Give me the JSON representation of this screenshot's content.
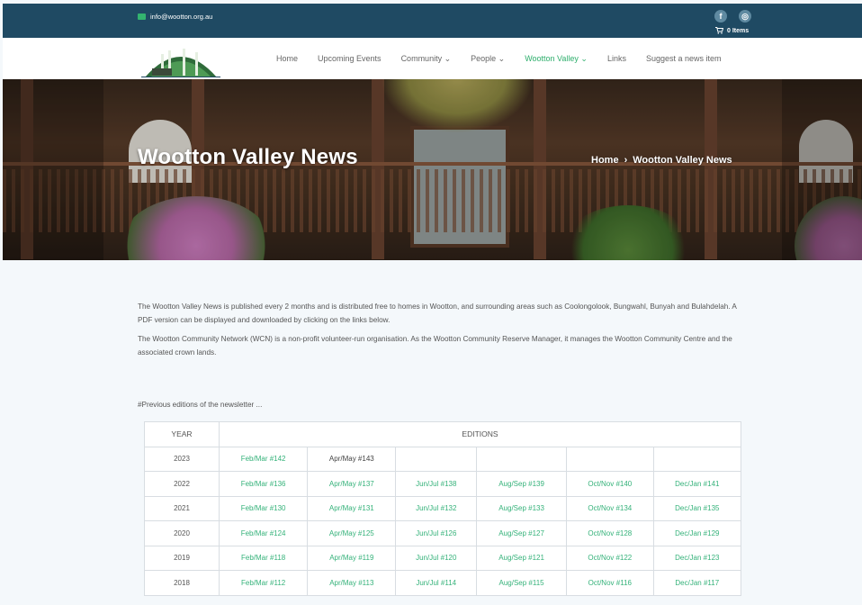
{
  "topbar": {
    "email": "info@wootton.org.au",
    "cart_label": "0 Items",
    "social": [
      {
        "icon": "facebook-icon",
        "glyph": "f"
      },
      {
        "icon": "instagram-icon",
        "glyph": "◎"
      }
    ]
  },
  "nav": {
    "items": [
      {
        "label": "Home",
        "active": false
      },
      {
        "label": "Upcoming Events",
        "active": false
      },
      {
        "label": "Community ⌄",
        "active": false
      },
      {
        "label": "People ⌄",
        "active": false
      },
      {
        "label": "Wootton Valley ⌄",
        "active": true
      },
      {
        "label": "Links",
        "active": false
      },
      {
        "label": "Suggest a news item",
        "active": false
      }
    ]
  },
  "hero": {
    "title": "Wootton Valley News",
    "breadcrumb_home": "Home",
    "breadcrumb_sep": "›",
    "breadcrumb_current": "Wootton Valley News"
  },
  "content": {
    "para1": "The Wootton Valley News is published every 2 months and is distributed free to homes in Wootton, and surrounding areas such as Coolongolook, Bungwahl, Bunyah and Bulahdelah.  A PDF version can be displayed and downloaded by clicking on the links below.",
    "para2": "The Wootton Community Network (WCN) is a non-profit volunteer-run organisation. As the Wootton Community Reserve Manager, it manages the Wootton Community Centre and the associated crown lands.",
    "previous": "#Previous editions of the newsletter ..."
  },
  "table": {
    "header_year": "YEAR",
    "header_editions": "EDITIONS",
    "rows": [
      {
        "year": "2023",
        "editions": [
          "Feb/Mar #142",
          "Apr/May #143",
          "",
          "",
          "",
          ""
        ]
      },
      {
        "year": "2022",
        "editions": [
          "Feb/Mar #136",
          "Apr/May #137",
          "Jun/Jul #138",
          "Aug/Sep #139",
          "Oct/Nov #140",
          "Dec/Jan #141"
        ]
      },
      {
        "year": "2021",
        "editions": [
          "Feb/Mar #130",
          "Apr/May #131",
          "Jun/Jul #132",
          "Aug/Sep #133",
          "Oct/Nov #134",
          "Dec/Jan #135"
        ]
      },
      {
        "year": "2020",
        "editions": [
          "Feb/Mar #124",
          "Apr/May #125",
          "Jun/Jul #126",
          "Aug/Sep #127",
          "Oct/Nov #128",
          "Dec/Jan #129"
        ]
      },
      {
        "year": "2019",
        "editions": [
          "Feb/Mar #118",
          "Apr/May #119",
          "Jun/Jul #120",
          "Aug/Sep #121",
          "Oct/Nov #122",
          "Dec/Jan #123"
        ]
      },
      {
        "year": "2018",
        "editions": [
          "Feb/Mar #112",
          "Apr/May #113",
          "Jun/Jul #114",
          "Aug/Sep #115",
          "Oct/Nov #116",
          "Dec/Jan #117"
        ]
      }
    ]
  },
  "colors": {
    "topbar": "#1f4a63",
    "accent_green": "#2eae6c",
    "link_green": "#35b27a"
  }
}
